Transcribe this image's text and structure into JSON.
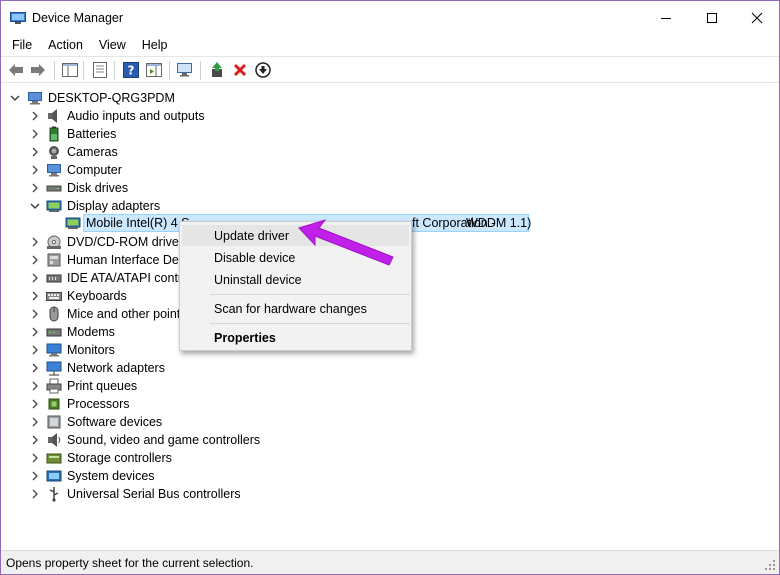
{
  "window": {
    "title": "Device Manager",
    "icon": "device-manager-icon"
  },
  "menubar": {
    "items": [
      "File",
      "Action",
      "View",
      "Help"
    ]
  },
  "toolbar": {
    "buttons": [
      "back-arrow-icon",
      "forward-arrow-icon",
      "show-hide-console-tree-icon",
      "properties-icon",
      "help-icon",
      "action-pane-icon",
      "scan-hardware-icon",
      "update-driver-icon",
      "uninstall-device-icon",
      "disable-device-icon"
    ]
  },
  "tree": {
    "root": "DESKTOP-QRG3PDM",
    "categories": [
      {
        "label": "Audio inputs and outputs",
        "icon": "speaker-icon"
      },
      {
        "label": "Batteries",
        "icon": "battery-icon"
      },
      {
        "label": "Cameras",
        "icon": "camera-icon"
      },
      {
        "label": "Computer",
        "icon": "computer-icon"
      },
      {
        "label": "Disk drives",
        "icon": "disk-drive-icon"
      },
      {
        "label": "Display adapters",
        "icon": "display-adapter-icon"
      },
      {
        "label": "DVD/CD-ROM drives",
        "icon": "dvd-icon"
      },
      {
        "label": "Human Interface Dev",
        "icon": "hid-icon"
      },
      {
        "label": "IDE ATA/ATAPI contro",
        "icon": "ide-icon"
      },
      {
        "label": "Keyboards",
        "icon": "keyboard-icon"
      },
      {
        "label": "Mice and other point",
        "icon": "mouse-icon"
      },
      {
        "label": "Modems",
        "icon": "modem-icon"
      },
      {
        "label": "Monitors",
        "icon": "monitor-icon"
      },
      {
        "label": "Network adapters",
        "icon": "network-icon"
      },
      {
        "label": "Print queues",
        "icon": "printer-icon"
      },
      {
        "label": "Processors",
        "icon": "processor-icon"
      },
      {
        "label": "Software devices",
        "icon": "software-device-icon"
      },
      {
        "label": "Sound, video and game controllers",
        "icon": "sound-icon"
      },
      {
        "label": "Storage controllers",
        "icon": "storage-icon"
      },
      {
        "label": "System devices",
        "icon": "system-device-icon"
      },
      {
        "label": "Universal Serial Bus controllers",
        "icon": "usb-icon"
      }
    ],
    "selected_child_left": "Mobile Intel(R) 4 S",
    "selected_child_right": "WDDM 1.1)",
    "selected_child_middle": "ft Corporation -"
  },
  "context_menu": {
    "update": "Update driver",
    "disable": "Disable device",
    "uninstall": "Uninstall device",
    "scan": "Scan for hardware changes",
    "properties": "Properties"
  },
  "statusbar": {
    "text": "Opens property sheet for the current selection."
  },
  "colors": {
    "selection": "#cce8ff",
    "annotation_arrow": "#c020e8",
    "window_border": "#8f6bb8"
  }
}
